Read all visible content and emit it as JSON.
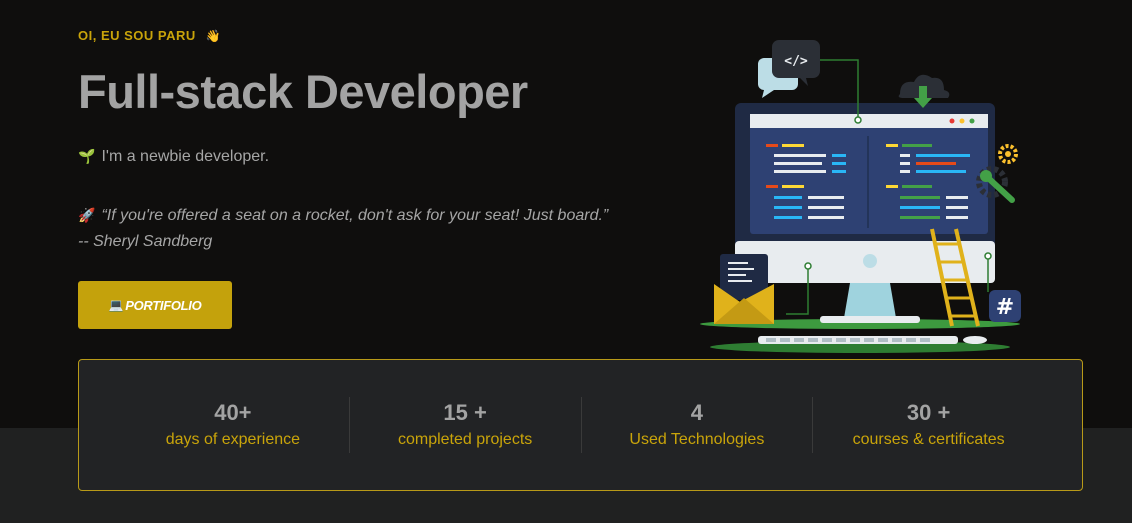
{
  "hero": {
    "greeting": "OI, EU SOU PARU",
    "greeting_emoji": "👋",
    "title": "Full-stack Developer",
    "intro_emoji": "🌱",
    "intro": "I'm a newbie developer.",
    "quote_emoji": "🚀",
    "quote": "“If you're offered a seat on a rocket, don't ask for your seat! Just board.” -- Sheryl Sandberg",
    "cta_icon": "💻",
    "cta_label": "PORTIFOLIO"
  },
  "illustration": {
    "code_symbol": "</>",
    "hash_symbol": "#"
  },
  "stats": [
    {
      "value": "40+",
      "label": "days of experience"
    },
    {
      "value": "15 +",
      "label": "completed projects"
    },
    {
      "value": "4",
      "label": "Used Technologies"
    },
    {
      "value": "30 +",
      "label": "courses & certificates"
    }
  ],
  "colors": {
    "background": "#0f0e0d",
    "accent": "#c4a20c",
    "card": "#222325",
    "band": "#202121"
  }
}
